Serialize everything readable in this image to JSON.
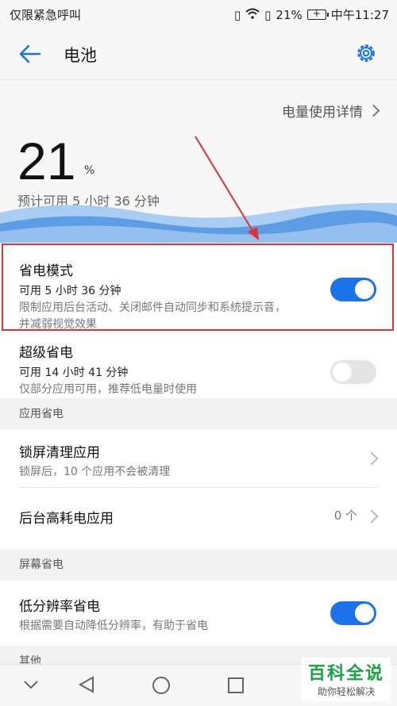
{
  "status_bar": {
    "carrier": "仅限紧急呼叫",
    "battery_percent": "21%",
    "time": "中午11:27"
  },
  "app_bar": {
    "title": "电池"
  },
  "hero": {
    "usage_link": "电量使用详情",
    "level": "21",
    "percent_sign": "%",
    "remaining": "预计可用 5 小时 36 分钟"
  },
  "power_saving": {
    "name": "省电模式",
    "available": "可用 5 小时 36 分钟",
    "desc_line1": "限制应用后台活动、关闭邮件自动同步和系统提示音，",
    "desc_line2": "并减弱视觉效果",
    "enabled": true
  },
  "ultra_power_saving": {
    "name": "超级省电",
    "available": "可用 14 小时 41 分钟",
    "desc": "仅部分应用可用，推荐低电量时使用",
    "enabled": false
  },
  "sections": {
    "app_saving": "应用省电",
    "screen_saving": "屏幕省电",
    "other": "其他"
  },
  "lockscreen_clean": {
    "name": "锁屏清理应用",
    "desc": "锁屏后，10 个应用不会被清理"
  },
  "background_apps": {
    "name": "后台高耗电应用",
    "count": "0 个"
  },
  "low_resolution": {
    "name": "低分辨率省电",
    "desc": "根据需要自动降低分辨率，有助于省电",
    "enabled": true
  },
  "watermark": {
    "title": "百科全说",
    "subtitle": "助你轻松解决"
  },
  "colors": {
    "accent": "#1a73e8",
    "annotation": "#dd3333"
  }
}
